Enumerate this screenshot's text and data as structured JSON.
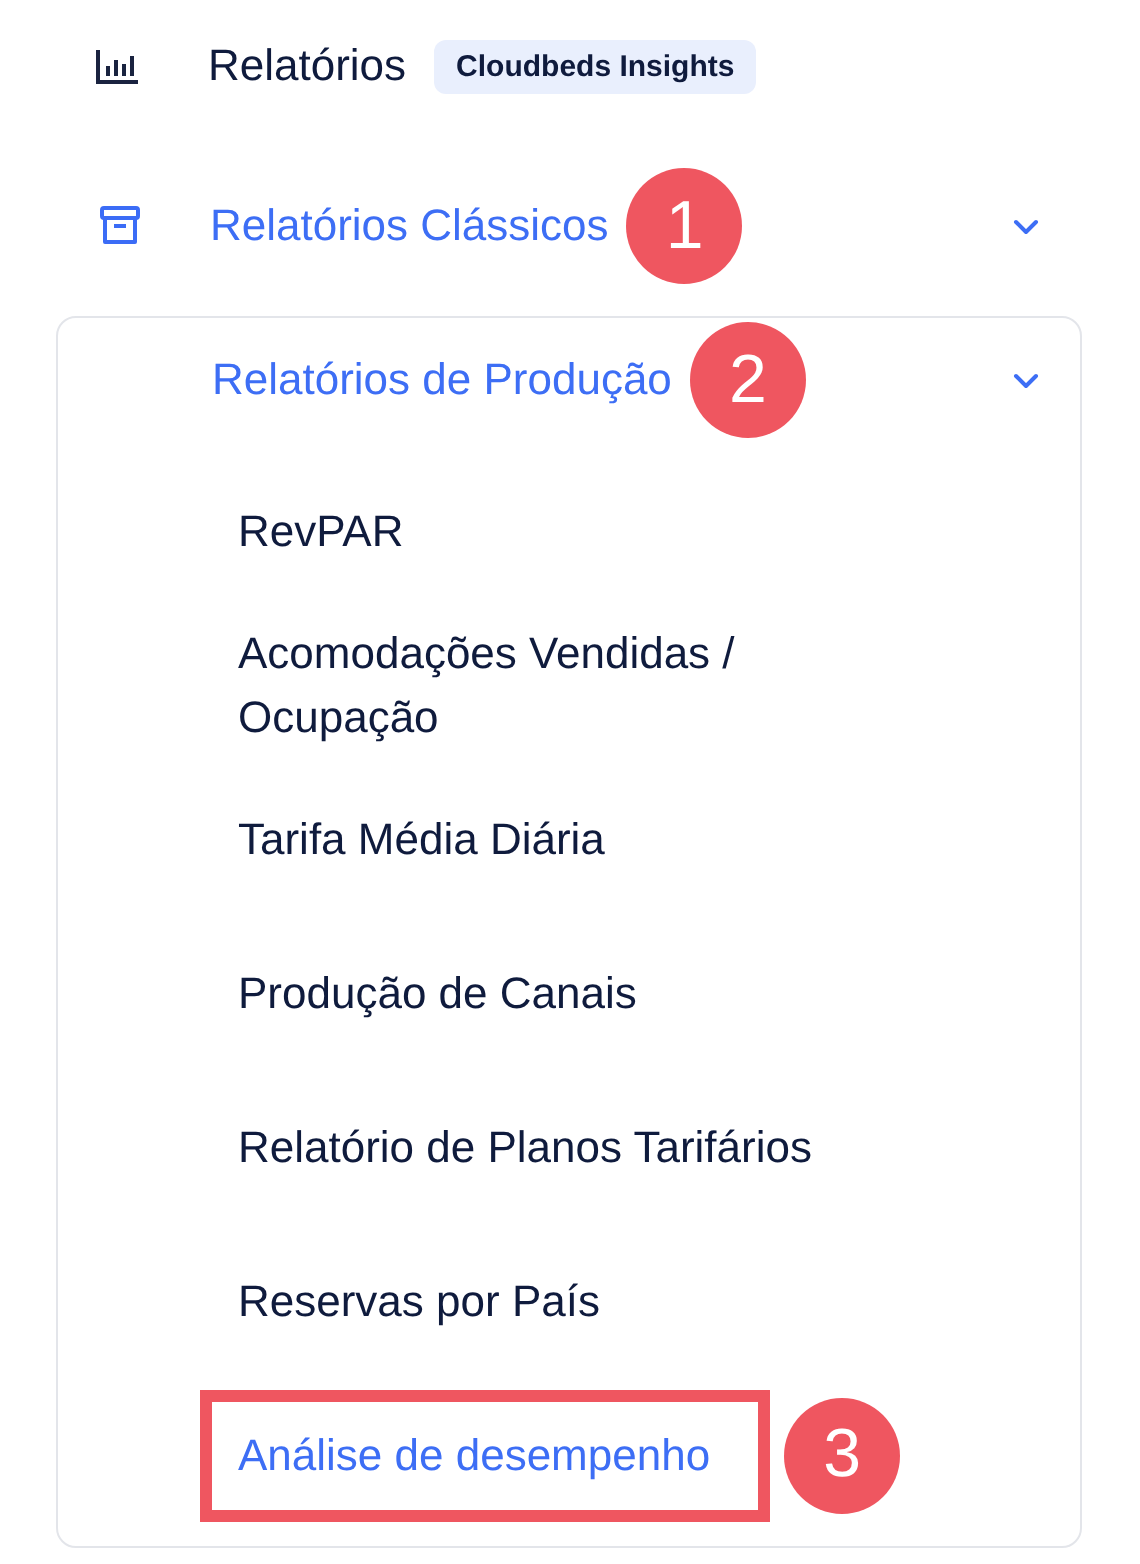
{
  "header": {
    "title": "Relatórios",
    "badge": "Cloudbeds Insights"
  },
  "section": {
    "label": "Relatórios Clássicos",
    "expanded": true,
    "marker": "1",
    "group": {
      "label": "Relatórios de Produção",
      "expanded": true,
      "marker": "2",
      "items": [
        {
          "label": "RevPAR",
          "selected": false,
          "highlighted": false
        },
        {
          "label": "Acomodações Vendidas / Ocupação",
          "selected": false,
          "highlighted": false
        },
        {
          "label": "Tarifa Média Diária",
          "selected": false,
          "highlighted": false
        },
        {
          "label": "Produção de Canais",
          "selected": false,
          "highlighted": false
        },
        {
          "label": "Relatório de Planos Tarifários",
          "selected": false,
          "highlighted": false
        },
        {
          "label": "Reservas por País",
          "selected": false,
          "highlighted": false
        },
        {
          "label": "Análise de desempenho",
          "selected": true,
          "highlighted": true,
          "marker": "3"
        }
      ]
    }
  }
}
